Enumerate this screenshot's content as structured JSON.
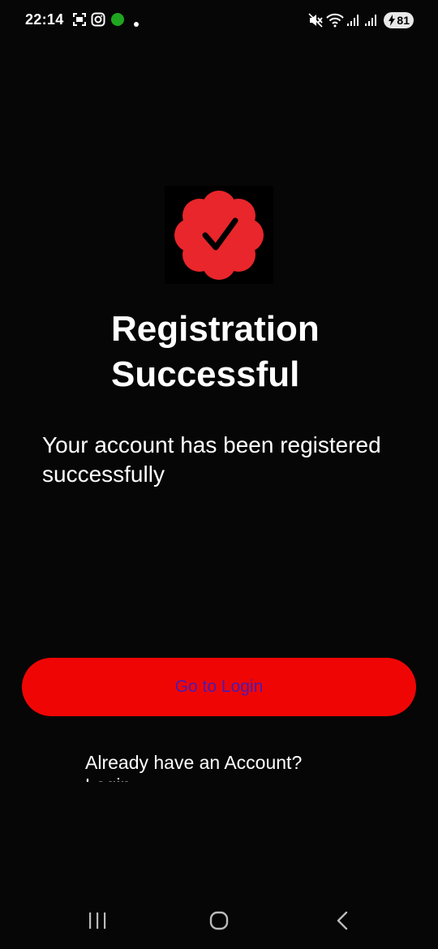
{
  "status_bar": {
    "time": "22:14",
    "battery": "81",
    "icons": [
      "screenshot-icon",
      "instagram-icon",
      "green-dot-icon",
      "notification-dot-icon",
      "mute-icon",
      "wifi-icon",
      "signal-icon",
      "signal-icon",
      "battery-icon"
    ]
  },
  "main": {
    "title": "Registration Successful",
    "message": "Your account has been registered successfully",
    "login_button": "Go to Login",
    "account_prompt": "Already have an Account?",
    "login_link": "Login"
  },
  "colors": {
    "background": "#060606",
    "accent": "#f00505",
    "badge": "#e8262b",
    "button_text": "#4b1bb0"
  },
  "nav_bar": {
    "buttons": [
      "recent-apps-icon",
      "home-icon",
      "back-icon"
    ]
  }
}
